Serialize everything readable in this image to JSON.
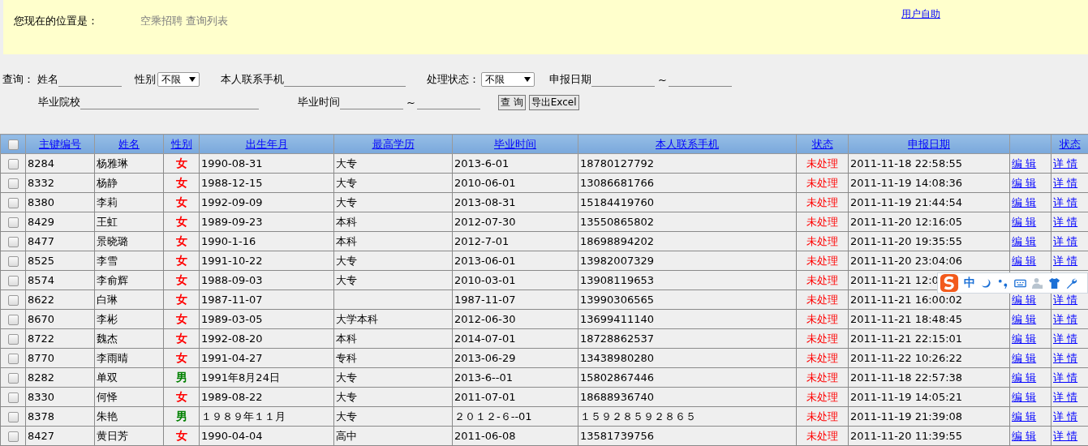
{
  "header": {
    "location_label": "您现在的位置是：",
    "breadcrumb": "空乘招聘 查询列表",
    "user_link": "用户自助"
  },
  "filters": {
    "query_label": "查询：",
    "name_label": "姓名",
    "gender_label": "性别",
    "gender_value": "不限",
    "phone_label": "本人联系手机",
    "status_label": "处理状态：",
    "status_value": "不限",
    "date_label": "申报日期",
    "date_sep": "~",
    "school_label": "毕业院校",
    "grad_label": "毕业时间",
    "grad_sep": "~",
    "search_button": "查 询",
    "export_button": "导出Excel"
  },
  "table": {
    "all_checked": false,
    "columns": [
      "主键编号",
      "姓名",
      "性别",
      "出生年月",
      "最高学历",
      "毕业时间",
      "本人联系手机",
      "状态",
      "申报日期",
      "状态"
    ],
    "rows": [
      {
        "checked": false,
        "id": "8284",
        "name": "杨雅琳",
        "gender": "女",
        "color": "#ff0000",
        "birth": "1990-08-31",
        "edu": "大专",
        "grad": "2013-6-01",
        "phone": "18780127792",
        "status": "未处理",
        "date": "2011-11-18 22:58:55",
        "edit": "编 辑",
        "detail": "详 情"
      },
      {
        "checked": false,
        "id": "8332",
        "name": "杨静",
        "gender": "女",
        "color": "#ff0000",
        "birth": "1988-12-15",
        "edu": "大专",
        "grad": "2010-06-01",
        "phone": "13086681766",
        "status": "未处理",
        "date": "2011-11-19 14:08:36",
        "edit": "编 辑",
        "detail": "详 情"
      },
      {
        "checked": false,
        "id": "8380",
        "name": "李莉",
        "gender": "女",
        "color": "#ff0000",
        "birth": "1992-09-09",
        "edu": "大专",
        "grad": "2013-08-31",
        "phone": "15184419760",
        "status": "未处理",
        "date": "2011-11-19 21:44:54",
        "edit": "编 辑",
        "detail": "详 情"
      },
      {
        "checked": false,
        "id": "8429",
        "name": "王虹",
        "gender": "女",
        "color": "#ff0000",
        "birth": "1989-09-23",
        "edu": "本科",
        "grad": "2012-07-30",
        "phone": "13550865802",
        "status": "未处理",
        "date": "2011-11-20 12:16:05",
        "edit": "编 辑",
        "detail": "详 情"
      },
      {
        "checked": false,
        "id": "8477",
        "name": "景晓璐",
        "gender": "女",
        "color": "#ff0000",
        "birth": "1990-1-16",
        "edu": "本科",
        "grad": "2012-7-01",
        "phone": "18698894202",
        "status": "未处理",
        "date": "2011-11-20 19:35:55",
        "edit": "编 辑",
        "detail": "详 情"
      },
      {
        "checked": false,
        "id": "8525",
        "name": "李雪",
        "gender": "女",
        "color": "#ff0000",
        "birth": "1991-10-22",
        "edu": "大专",
        "grad": "2013-06-01",
        "phone": "13982007329",
        "status": "未处理",
        "date": "2011-11-20 23:04:06",
        "edit": "编 辑",
        "detail": "详 情"
      },
      {
        "checked": false,
        "id": "8574",
        "name": "李俞辉",
        "gender": "女",
        "color": "#ff0000",
        "birth": "1988-09-03",
        "edu": "大专",
        "grad": "2010-03-01",
        "phone": "13908119653",
        "status": "未处理",
        "date": "2011-11-21 12:0"
      },
      {
        "checked": false,
        "id": "8622",
        "name": "白琳",
        "gender": "女",
        "color": "#ff0000",
        "birth": "1987-11-07",
        "grad": "1987-11-07",
        "phone": "13990306565",
        "status": "未处理",
        "date": "2011-11-21 16:00:02",
        "edit": "编 辑",
        "detail": "详 情"
      },
      {
        "checked": false,
        "id": "8670",
        "name": "李彬",
        "gender": "女",
        "color": "#ff0000",
        "birth": "1989-03-05",
        "edu": "大学本科",
        "grad": "2012-06-30",
        "phone": "13699411140",
        "status": "未处理",
        "date": "2011-11-21 18:48:45",
        "edit": "编 辑",
        "detail": "详 情"
      },
      {
        "checked": false,
        "id": "8722",
        "name": "魏杰",
        "gender": "女",
        "color": "#ff0000",
        "birth": "1992-08-20",
        "edu": "本科",
        "grad": "2014-07-01",
        "phone": "18728862537",
        "status": "未处理",
        "date": "2011-11-21 22:15:01",
        "edit": "编 辑",
        "detail": "详 情"
      },
      {
        "checked": false,
        "id": "8770",
        "name": "李雨晴",
        "gender": "女",
        "color": "#ff0000",
        "birth": "1991-04-27",
        "edu": "专科",
        "grad": "2013-06-29",
        "phone": "13438980280",
        "status": "未处理",
        "date": "2011-11-22 10:26:22",
        "edit": "编 辑",
        "detail": "详 情"
      },
      {
        "checked": false,
        "id": "8282",
        "name": "单双",
        "gender": "男",
        "color": "#008000",
        "birth": "1991年8月24日",
        "edu": "大专",
        "grad": "2013-6--01",
        "phone": "15802867446",
        "status": "未处理",
        "date": "2011-11-18 22:57:38",
        "edit": "编 辑",
        "detail": "详 情"
      },
      {
        "checked": false,
        "id": "8330",
        "name": "何怿",
        "gender": "女",
        "color": "#ff0000",
        "birth": "1989-08-22",
        "edu": "大专",
        "grad": "2011-07-01",
        "phone": "18688936740",
        "status": "未处理",
        "date": "2011-11-19 14:05:21",
        "edit": "编 辑",
        "detail": "详 情"
      },
      {
        "checked": false,
        "id": "8378",
        "name": "朱艳",
        "gender": "男",
        "color": "#008000",
        "birth": "１９８９年１１月",
        "edu": "大专",
        "grad": "２０１２-６--01",
        "phone": "１５９２８５９２８６５",
        "status": "未处理",
        "date": "2011-11-19 21:39:08",
        "edit": "编 辑",
        "detail": "详 情"
      },
      {
        "checked": false,
        "id": "8427",
        "name": "黄日芳",
        "gender": "女",
        "color": "#ff0000",
        "birth": "1990-04-04",
        "edu": "高中",
        "grad": "2011-06-08",
        "phone": "13581739756",
        "status": "未处理",
        "date": "2011-11-20 11:39:55",
        "edit": "编 辑",
        "detail": "详 情"
      }
    ]
  },
  "ime_toolbar": {
    "mode": "中"
  }
}
